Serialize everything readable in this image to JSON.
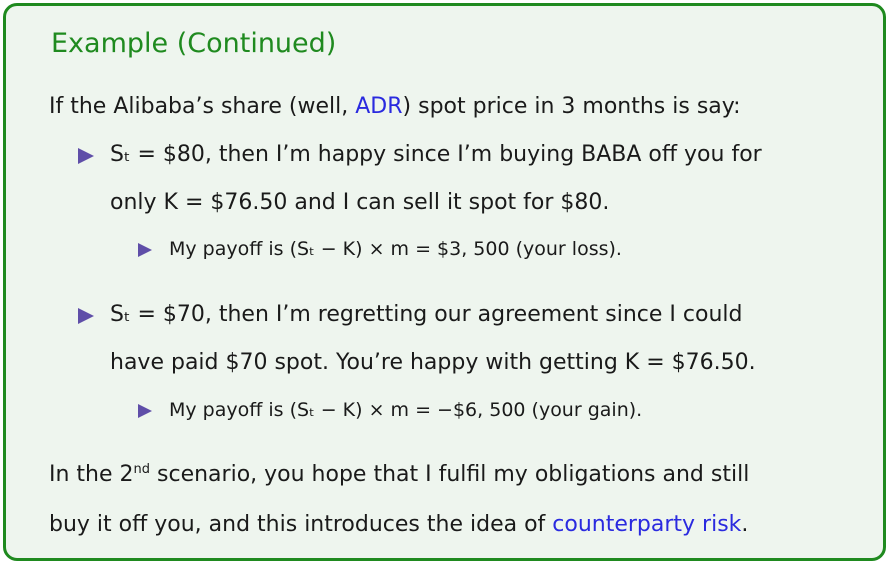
{
  "title": "Example (Continued)",
  "intro": {
    "before": "If the Alibaba’s share (well, ",
    "link": "ADR",
    "after": ") spot price in 3 months is say:"
  },
  "bullet1": {
    "line1": "Sₜ = $80, then I’m happy since I’m buying BABA off you for",
    "line2": "only K = $76.50 and I can sell it spot for $80.",
    "sub": "My payoff is (Sₜ − K) × m = $3, 500 (your loss)."
  },
  "bullet2": {
    "line1": "Sₜ = $70, then I’m regretting our agreement since I could",
    "line2": "have paid $70 spot. You’re happy with getting K = $76.50.",
    "sub": "My payoff is (Sₜ − K) × m = −$6, 500 (your gain)."
  },
  "outro": {
    "line1_before": "In the 2",
    "line1_sup": "nd",
    "line1_after": " scenario, you hope that I fulfil my obligations and still",
    "line2_before": "buy it off you, and this introduces the idea of ",
    "line2_link": "counterparty risk",
    "line2_after": "."
  },
  "colors": {
    "frame": "#1f8a1f",
    "background": "#eef5ee",
    "bullet": "#5f4ea8",
    "link": "#2a2adf"
  }
}
